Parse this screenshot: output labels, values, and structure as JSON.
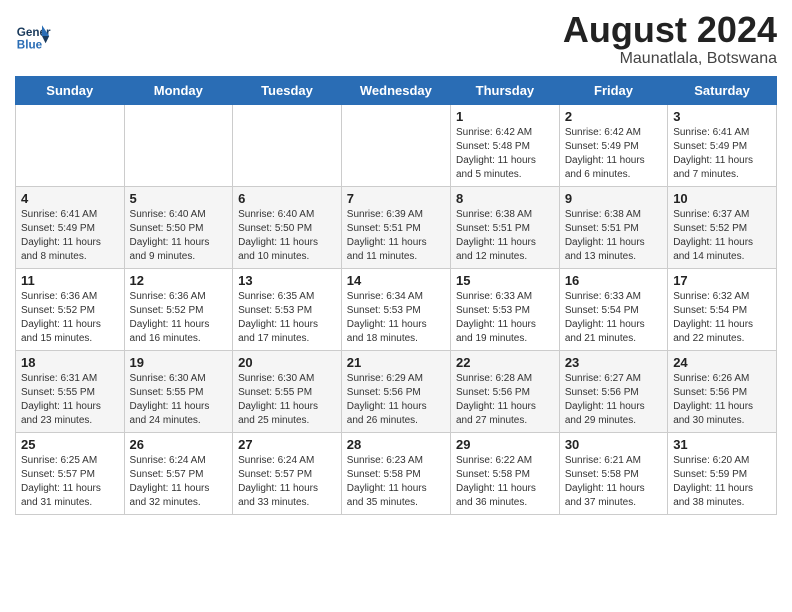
{
  "header": {
    "logo_line1": "General",
    "logo_line2": "Blue",
    "month_year": "August 2024",
    "location": "Maunatlala, Botswana"
  },
  "columns": [
    "Sunday",
    "Monday",
    "Tuesday",
    "Wednesday",
    "Thursday",
    "Friday",
    "Saturday"
  ],
  "weeks": [
    [
      {
        "day": "",
        "info": ""
      },
      {
        "day": "",
        "info": ""
      },
      {
        "day": "",
        "info": ""
      },
      {
        "day": "",
        "info": ""
      },
      {
        "day": "1",
        "info": "Sunrise: 6:42 AM\nSunset: 5:48 PM\nDaylight: 11 hours\nand 5 minutes."
      },
      {
        "day": "2",
        "info": "Sunrise: 6:42 AM\nSunset: 5:49 PM\nDaylight: 11 hours\nand 6 minutes."
      },
      {
        "day": "3",
        "info": "Sunrise: 6:41 AM\nSunset: 5:49 PM\nDaylight: 11 hours\nand 7 minutes."
      }
    ],
    [
      {
        "day": "4",
        "info": "Sunrise: 6:41 AM\nSunset: 5:49 PM\nDaylight: 11 hours\nand 8 minutes."
      },
      {
        "day": "5",
        "info": "Sunrise: 6:40 AM\nSunset: 5:50 PM\nDaylight: 11 hours\nand 9 minutes."
      },
      {
        "day": "6",
        "info": "Sunrise: 6:40 AM\nSunset: 5:50 PM\nDaylight: 11 hours\nand 10 minutes."
      },
      {
        "day": "7",
        "info": "Sunrise: 6:39 AM\nSunset: 5:51 PM\nDaylight: 11 hours\nand 11 minutes."
      },
      {
        "day": "8",
        "info": "Sunrise: 6:38 AM\nSunset: 5:51 PM\nDaylight: 11 hours\nand 12 minutes."
      },
      {
        "day": "9",
        "info": "Sunrise: 6:38 AM\nSunset: 5:51 PM\nDaylight: 11 hours\nand 13 minutes."
      },
      {
        "day": "10",
        "info": "Sunrise: 6:37 AM\nSunset: 5:52 PM\nDaylight: 11 hours\nand 14 minutes."
      }
    ],
    [
      {
        "day": "11",
        "info": "Sunrise: 6:36 AM\nSunset: 5:52 PM\nDaylight: 11 hours\nand 15 minutes."
      },
      {
        "day": "12",
        "info": "Sunrise: 6:36 AM\nSunset: 5:52 PM\nDaylight: 11 hours\nand 16 minutes."
      },
      {
        "day": "13",
        "info": "Sunrise: 6:35 AM\nSunset: 5:53 PM\nDaylight: 11 hours\nand 17 minutes."
      },
      {
        "day": "14",
        "info": "Sunrise: 6:34 AM\nSunset: 5:53 PM\nDaylight: 11 hours\nand 18 minutes."
      },
      {
        "day": "15",
        "info": "Sunrise: 6:33 AM\nSunset: 5:53 PM\nDaylight: 11 hours\nand 19 minutes."
      },
      {
        "day": "16",
        "info": "Sunrise: 6:33 AM\nSunset: 5:54 PM\nDaylight: 11 hours\nand 21 minutes."
      },
      {
        "day": "17",
        "info": "Sunrise: 6:32 AM\nSunset: 5:54 PM\nDaylight: 11 hours\nand 22 minutes."
      }
    ],
    [
      {
        "day": "18",
        "info": "Sunrise: 6:31 AM\nSunset: 5:55 PM\nDaylight: 11 hours\nand 23 minutes."
      },
      {
        "day": "19",
        "info": "Sunrise: 6:30 AM\nSunset: 5:55 PM\nDaylight: 11 hours\nand 24 minutes."
      },
      {
        "day": "20",
        "info": "Sunrise: 6:30 AM\nSunset: 5:55 PM\nDaylight: 11 hours\nand 25 minutes."
      },
      {
        "day": "21",
        "info": "Sunrise: 6:29 AM\nSunset: 5:56 PM\nDaylight: 11 hours\nand 26 minutes."
      },
      {
        "day": "22",
        "info": "Sunrise: 6:28 AM\nSunset: 5:56 PM\nDaylight: 11 hours\nand 27 minutes."
      },
      {
        "day": "23",
        "info": "Sunrise: 6:27 AM\nSunset: 5:56 PM\nDaylight: 11 hours\nand 29 minutes."
      },
      {
        "day": "24",
        "info": "Sunrise: 6:26 AM\nSunset: 5:56 PM\nDaylight: 11 hours\nand 30 minutes."
      }
    ],
    [
      {
        "day": "25",
        "info": "Sunrise: 6:25 AM\nSunset: 5:57 PM\nDaylight: 11 hours\nand 31 minutes."
      },
      {
        "day": "26",
        "info": "Sunrise: 6:24 AM\nSunset: 5:57 PM\nDaylight: 11 hours\nand 32 minutes."
      },
      {
        "day": "27",
        "info": "Sunrise: 6:24 AM\nSunset: 5:57 PM\nDaylight: 11 hours\nand 33 minutes."
      },
      {
        "day": "28",
        "info": "Sunrise: 6:23 AM\nSunset: 5:58 PM\nDaylight: 11 hours\nand 35 minutes."
      },
      {
        "day": "29",
        "info": "Sunrise: 6:22 AM\nSunset: 5:58 PM\nDaylight: 11 hours\nand 36 minutes."
      },
      {
        "day": "30",
        "info": "Sunrise: 6:21 AM\nSunset: 5:58 PM\nDaylight: 11 hours\nand 37 minutes."
      },
      {
        "day": "31",
        "info": "Sunrise: 6:20 AM\nSunset: 5:59 PM\nDaylight: 11 hours\nand 38 minutes."
      }
    ]
  ]
}
